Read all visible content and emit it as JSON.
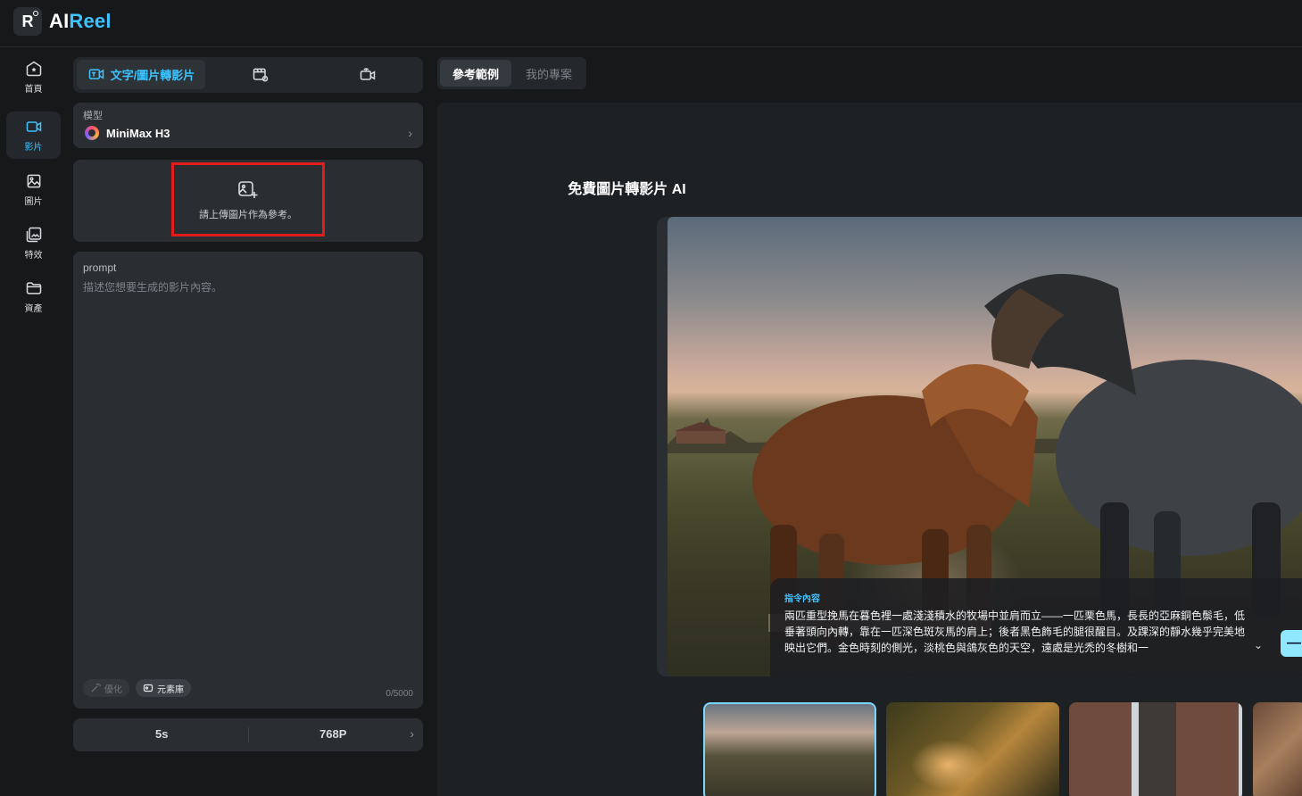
{
  "app": {
    "logo_text_prefix": "AI",
    "logo_text_suffix": "Reel",
    "accent_color": "#3ec3ff"
  },
  "nav": {
    "items": [
      {
        "label": "首頁",
        "icon": "home-icon"
      },
      {
        "label": "影片",
        "icon": "video-camera-icon",
        "active": true
      },
      {
        "label": "圖片",
        "icon": "image-icon"
      },
      {
        "label": "特效",
        "icon": "effects-icon"
      },
      {
        "label": "資產",
        "icon": "folder-icon"
      }
    ]
  },
  "panel": {
    "tabs": [
      {
        "label": "文字/圖片轉影片",
        "icon": "text-image-to-video-icon",
        "active": true
      },
      {
        "label": "",
        "icon": "video-reference-icon"
      },
      {
        "label": "",
        "icon": "camera-swap-icon"
      }
    ],
    "model": {
      "label": "模型",
      "name": "MiniMax H3"
    },
    "upload": {
      "text": "請上傳圖片作為參考。",
      "icon": "image-add-icon"
    },
    "prompt": {
      "label": "prompt",
      "placeholder": "描述您想要生成的影片內容。",
      "value": "",
      "optimize_label": "優化",
      "library_label": "元素庫",
      "counter": "0/5000"
    },
    "settings": {
      "duration": "5s",
      "resolution": "768P"
    }
  },
  "right": {
    "tabs": [
      {
        "label": "參考範例",
        "active": true
      },
      {
        "label": "我的專案",
        "active": false
      }
    ],
    "title": "免費圖片轉影片 AI",
    "caption": {
      "label": "指令內容",
      "text": "兩匹重型挽馬在暮色裡一處淺淺積水的牧場中並肩而立——一匹栗色馬，長長的亞麻銅色鬃毛，低垂著頭向內轉，靠在一匹深色斑灰馬的肩上；後者黑色飾毛的腿很醒目。及踝深的靜水幾乎完美地映出它們。金色時刻的側光，淡桃色與鴿灰色的天空，遠處是光禿的冬樹和一"
    },
    "thumbnails": [
      {
        "name": "horses",
        "selected": true
      },
      {
        "name": "mountain-bike",
        "selected": false
      },
      {
        "name": "city-aerial",
        "selected": false
      },
      {
        "name": "portrait",
        "selected": false
      }
    ]
  }
}
